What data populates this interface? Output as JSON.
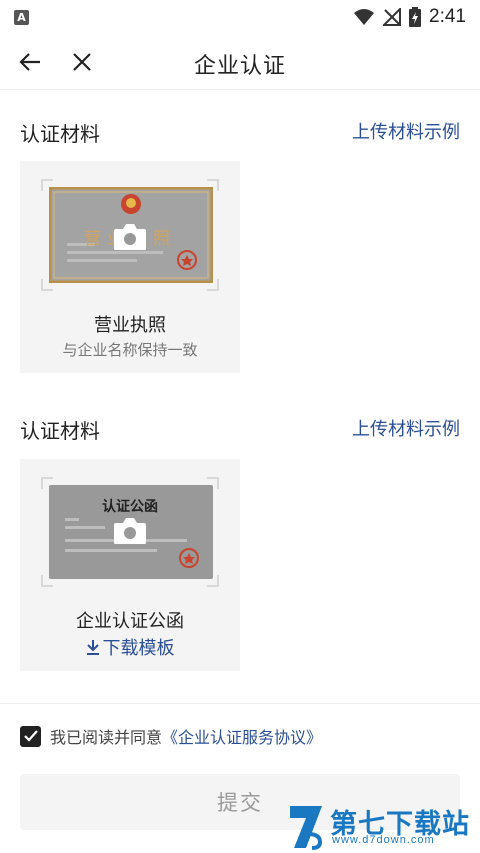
{
  "status_bar": {
    "time": "2:41",
    "app_badge": "A"
  },
  "header": {
    "title": "企业认证"
  },
  "sections": [
    {
      "title": "认证材料",
      "example_link": "上传材料示例",
      "card": {
        "doc_heading": "营业执照",
        "title": "营业执照",
        "subtitle": "与企业名称保持一致"
      }
    },
    {
      "title": "认证材料",
      "example_link": "上传材料示例",
      "card": {
        "doc_heading": "认证公函",
        "title": "企业认证公函",
        "download_label": "下载模板"
      }
    }
  ],
  "agreement": {
    "checked": true,
    "text": "我已阅读并同意",
    "link": "《企业认证服务协议》"
  },
  "submit_label": "提交",
  "watermark": {
    "brand": "第七下载站",
    "url": "www.d7down.com"
  },
  "colors": {
    "link": "#2b4f97",
    "card_bg": "#f4f4f4",
    "watermark": "#1a78c2"
  }
}
